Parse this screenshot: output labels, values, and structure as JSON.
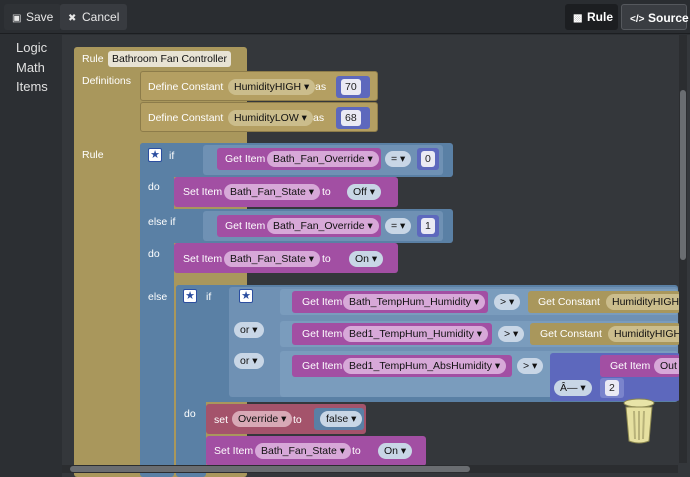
{
  "toolbar": {
    "save_label": "Save",
    "cancel_label": "Cancel",
    "rule_label": "Rule",
    "source_label": "Source"
  },
  "toolbox": {
    "items": [
      "Logic",
      "Math",
      "Items"
    ]
  },
  "rule": {
    "header_label": "Rule",
    "name": "Bathroom Fan Controller",
    "definitions_label": "Definitions",
    "rule_label": "Rule",
    "const1": {
      "label": "Define Constant",
      "name": "HumidityHIGH",
      "as": "as",
      "value": "70"
    },
    "const2": {
      "label": "Define Constant",
      "name": "HumidityLOW",
      "as": "as",
      "value": "68"
    },
    "if1": {
      "if": "if",
      "get": "Get Item",
      "item": "Bath_Fan_Override",
      "op": "=",
      "value": "0"
    },
    "do1": {
      "do": "do",
      "set": "Set Item",
      "item": "Bath_Fan_State",
      "to": "to",
      "value": "Off"
    },
    "elseif": {
      "label": "else if",
      "get": "Get Item",
      "item": "Bath_Fan_Override",
      "op": "=",
      "value": "1"
    },
    "do2": {
      "do": "do",
      "set": "Set Item",
      "item": "Bath_Fan_State",
      "to": "to",
      "value": "On"
    },
    "else_label": "else",
    "inner_if": {
      "if": "if",
      "row1": {
        "get": "Get Item",
        "item": "Bath_TempHum_Humidity",
        "op": ">",
        "const_label": "Get Constant",
        "const": "HumidityHIGH"
      },
      "row2": {
        "or": "or",
        "get": "Get Item",
        "item": "Bed1_TempHum_Humidity",
        "op": ">",
        "const_label": "Get Constant",
        "const": "HumidityHIGH"
      },
      "row3": {
        "or": "or",
        "get": "Get Item",
        "item": "Bed1_TempHum_AbsHumidity",
        "op": ">",
        "get2": "Get Item",
        "item2": "Out",
        "math_op": "Â—",
        "value": "2"
      }
    },
    "inner_do": {
      "do": "do",
      "set_label": "set",
      "var": "Override",
      "to": "to",
      "var_value": "false",
      "set_item": "Set Item",
      "item": "Bath_Fan_State",
      "to2": "to",
      "value": "On"
    }
  },
  "colors": {
    "rule": "#a9975c",
    "logic": "#5a80a5",
    "items": "#a24fa3",
    "const": "#a9975c",
    "math": "#5d68bd",
    "var": "#a4536b"
  }
}
